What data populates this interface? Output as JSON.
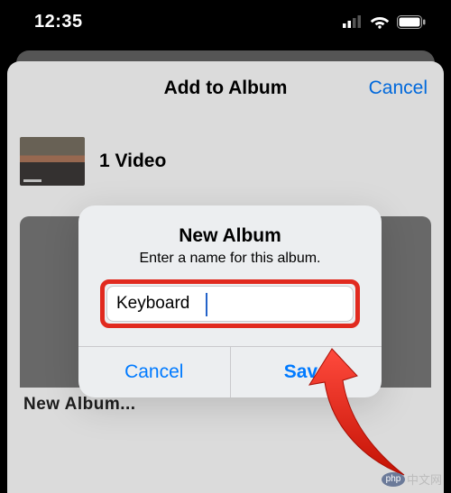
{
  "status": {
    "time": "12:35"
  },
  "sheet": {
    "title": "Add to Album",
    "cancel": "Cancel",
    "video_count": "1 Video",
    "new_album_label": "New Album..."
  },
  "alert": {
    "title": "New Album",
    "message": "Enter a name for this album.",
    "input_value": "Keyboard",
    "cancel": "Cancel",
    "save": "Save"
  },
  "watermark": {
    "logo": "php",
    "text": "中文网"
  }
}
